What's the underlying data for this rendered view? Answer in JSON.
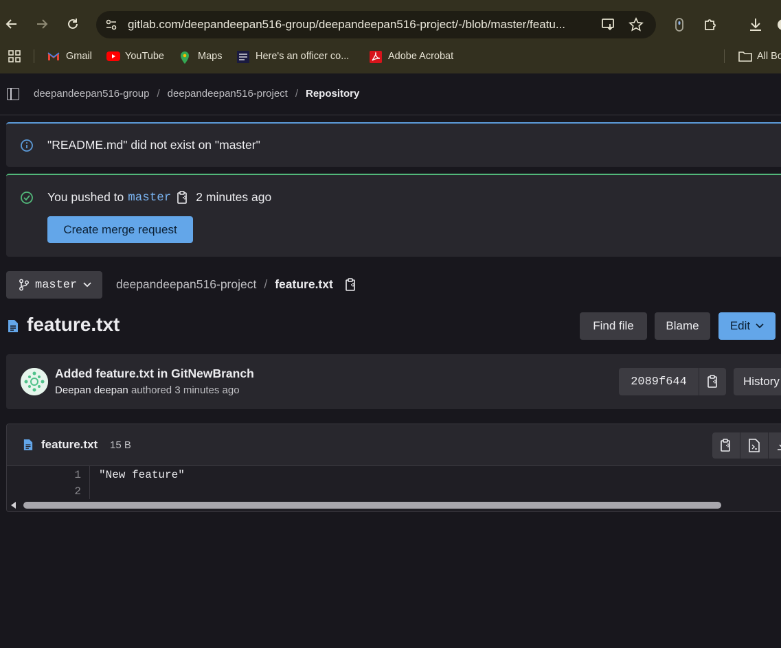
{
  "browser": {
    "url": "gitlab.com/deepandeepan516-group/deepandeepan516-project/-/blob/master/featu...",
    "bookmarks": [
      {
        "label": "Gmail",
        "icon": "gmail-icon"
      },
      {
        "label": "YouTube",
        "icon": "youtube-icon"
      },
      {
        "label": "Maps",
        "icon": "maps-icon"
      },
      {
        "label": "Here's an officer co...",
        "icon": "news-icon"
      },
      {
        "label": "Adobe Acrobat",
        "icon": "acrobat-icon"
      }
    ],
    "all_bookmarks_label": "All Bo"
  },
  "breadcrumbs": {
    "group": "deepandeepan516-group",
    "project": "deepandeepan516-project",
    "current": "Repository",
    "separator": "/"
  },
  "alerts": {
    "info_text": "\"README.md\" did not exist on \"master\"",
    "push_prefix": "You pushed to",
    "push_branch": "master",
    "push_time": "2 minutes ago",
    "merge_button": "Create merge request"
  },
  "branch": {
    "name": "master",
    "path_project": "deepandeepan516-project",
    "path_file": "feature.txt"
  },
  "file": {
    "title": "feature.txt",
    "find_file": "Find file",
    "blame": "Blame",
    "edit": "Edit"
  },
  "commit": {
    "title": "Added feature.txt in GitNewBranch",
    "author": "Deepan deepan",
    "meta": "authored 3 minutes ago",
    "sha": "2089f644",
    "history": "History"
  },
  "blob": {
    "name": "feature.txt",
    "size": "15 B",
    "lines": [
      {
        "number": "1",
        "text": "\"New feature\""
      },
      {
        "number": "2",
        "text": ""
      }
    ]
  },
  "colors": {
    "accent": "#63a6e9",
    "success": "#52b87a",
    "info": "#5c9bd9",
    "background": "#18171d"
  }
}
